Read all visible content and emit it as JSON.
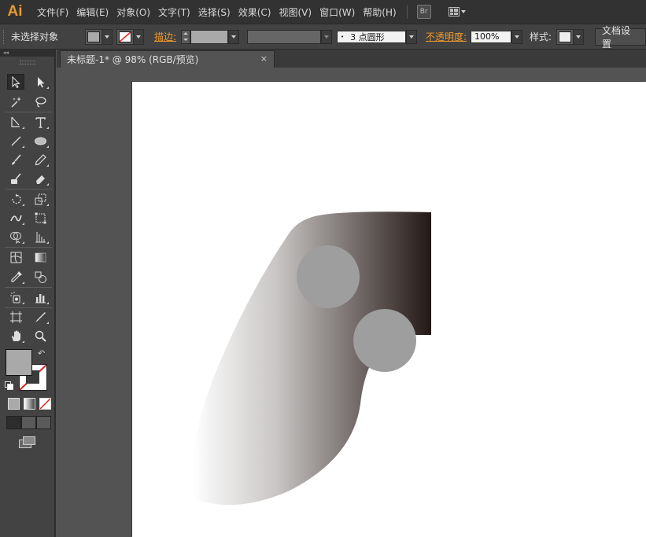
{
  "app": {
    "logo": "Ai"
  },
  "menu": [
    "文件(F)",
    "编辑(E)",
    "对象(O)",
    "文字(T)",
    "选择(S)",
    "效果(C)",
    "视图(V)",
    "窗口(W)",
    "帮助(H)"
  ],
  "menu_extra": {
    "bridge_label": "Br"
  },
  "control": {
    "selection_status": "未选择对象",
    "stroke_label": "描边:",
    "brush_stroke": "3 点圆形",
    "opacity_label": "不透明度:",
    "opacity_value": "100%",
    "style_label": "样式:",
    "doc_setup_button": "文档设置",
    "fill_color": "#a9a9a9"
  },
  "tools_panel": {
    "collapse_label": "◂◂"
  },
  "document": {
    "tab_title": "未标题-1* @ 98% (RGB/预览)",
    "tab_close": "×"
  },
  "artwork": {
    "gradient_start": "#ffffff",
    "gradient_end": "#231815",
    "circle_color": "#9e9e9e"
  }
}
